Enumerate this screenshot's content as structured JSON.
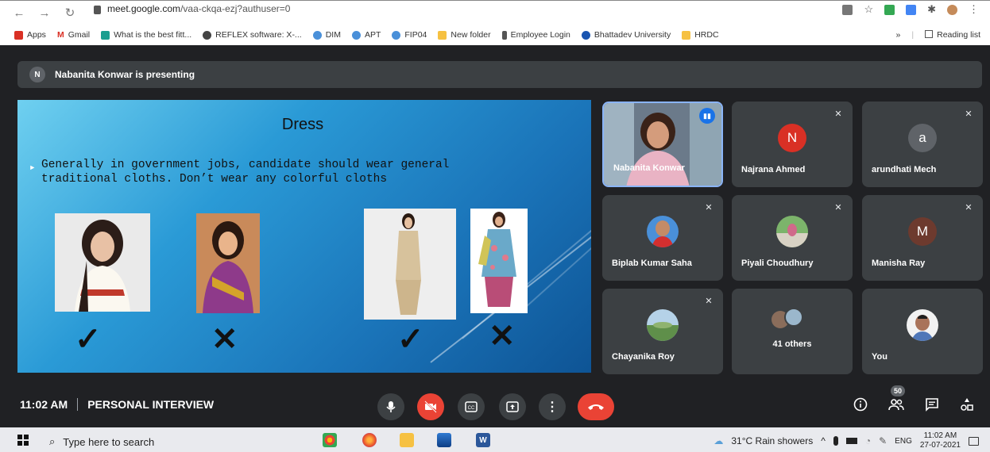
{
  "browser": {
    "url_host": "meet.google.com",
    "url_path": "/vaa-ckqa-ezj?authuser=0",
    "bookmarks": [
      "Apps",
      "Gmail",
      "What is the best fitt...",
      "REFLEX software: X-...",
      "DIM",
      "APT",
      "FIP04",
      "New folder",
      "Employee Login",
      "Bhattadev University",
      "HRDC"
    ],
    "overflow": "»",
    "reading_list": "Reading list"
  },
  "presenting": {
    "avatar_letter": "N",
    "text": "Nabanita Konwar is presenting"
  },
  "slide": {
    "title": "Dress",
    "bullet_line1": "Generally in government jobs, candidate should wear general",
    "bullet_line2": "traditional cloths. Don’t wear any colorful cloths",
    "marks": [
      "✓",
      "✕",
      "✓",
      "✕"
    ]
  },
  "participants": [
    {
      "name": "Nabanita Konwar",
      "type": "video",
      "speaking": true
    },
    {
      "name": "Najrana Ahmed",
      "letter": "N",
      "color": "#d93025",
      "muted": true
    },
    {
      "name": "arundhati Mech",
      "letter": "a",
      "color": "#5f6368",
      "muted": true
    },
    {
      "name": "Biplab Kumar Saha",
      "type": "photo",
      "muted": true
    },
    {
      "name": "Piyali Choudhury",
      "type": "photo",
      "muted": true
    },
    {
      "name": "Manisha Ray",
      "letter": "M",
      "color": "#6d3a2e",
      "muted": true
    },
    {
      "name": "Chayanika Roy",
      "type": "photo",
      "muted": true
    },
    {
      "name": "41 others",
      "type": "group"
    },
    {
      "name": "You",
      "type": "photo"
    }
  ],
  "bottom": {
    "time": "11:02 AM",
    "meeting_name": "PERSONAL INTERVIEW",
    "people_count": "50"
  },
  "taskbar": {
    "search_placeholder": "Type here to search",
    "weather": "31°C  Rain showers",
    "lang": "ENG",
    "time": "11:02 AM",
    "date": "27-07-2021"
  }
}
